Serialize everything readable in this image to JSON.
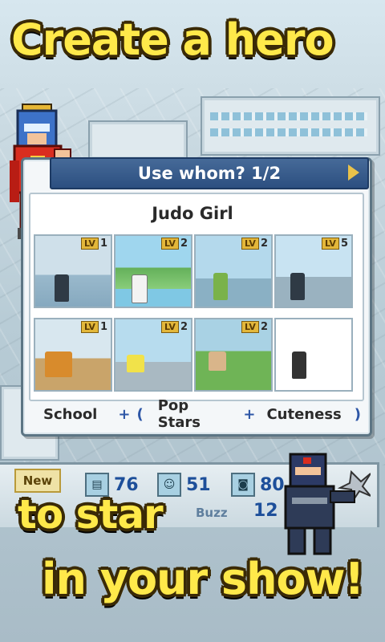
{
  "headline": {
    "top": "Create a hero",
    "middle": "to star",
    "bottom": "in your show!"
  },
  "dialog": {
    "title": "Use whom? 1/2",
    "selected_name": "Judo Girl",
    "cards": [
      {
        "level_tag": "LV",
        "level": "1"
      },
      {
        "level_tag": "LV",
        "level": "2"
      },
      {
        "level_tag": "LV",
        "level": "2"
      },
      {
        "level_tag": "LV",
        "level": "5"
      },
      {
        "level_tag": "LV",
        "level": "1"
      },
      {
        "level_tag": "LV",
        "level": "2"
      },
      {
        "level_tag": "LV",
        "level": "2"
      },
      {
        "level_tag": "",
        "level": ""
      }
    ],
    "traits": {
      "first": "School",
      "plus1": "+",
      "open_paren": "(",
      "second": "Pop Stars",
      "plus2": "+",
      "third": "Cuteness",
      "close_paren": ")"
    }
  },
  "hud": {
    "new_badge": "New",
    "stat1": "76",
    "stat2": "51",
    "stat3": "80",
    "buzz_label": "Buzz",
    "buzz_value": "12"
  },
  "colors": {
    "headline_yellow": "#ffe94a",
    "header_blue": "#2c4f80",
    "stat_blue": "#1d4f9a"
  }
}
